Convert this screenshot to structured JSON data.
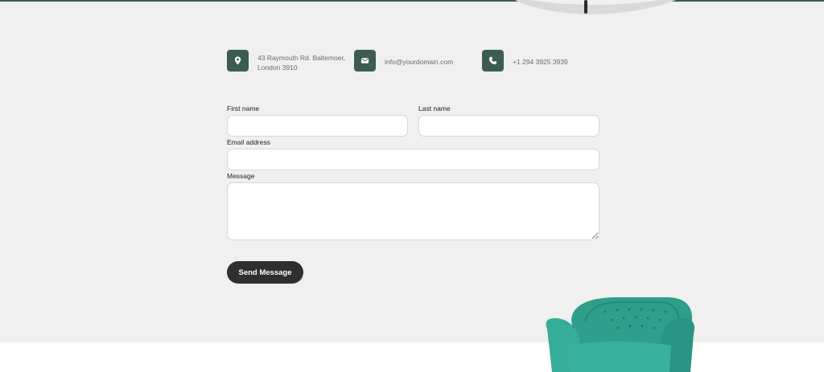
{
  "contact": {
    "address": {
      "icon": "location-pin-icon",
      "line1": "43 Raymouth Rd. Baltemoer,",
      "line2": "London 3910"
    },
    "email": {
      "icon": "envelope-icon",
      "text": "info@yourdomain.com"
    },
    "phone": {
      "icon": "phone-icon",
      "text": "+1 294 3925 3939"
    }
  },
  "form": {
    "first_name": {
      "label": "First name",
      "value": ""
    },
    "last_name": {
      "label": "Last name",
      "value": ""
    },
    "email": {
      "label": "Email address",
      "value": ""
    },
    "message": {
      "label": "Message",
      "value": ""
    },
    "submit_label": "Send Message"
  },
  "colors": {
    "accent": "#3b5d50",
    "background": "#eff0ef",
    "button": "#2f2f2f",
    "armchair": "#2f9e8b"
  }
}
